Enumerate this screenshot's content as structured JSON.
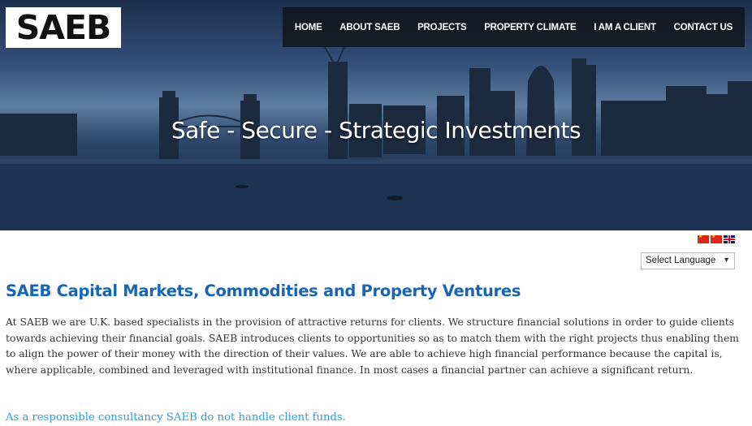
{
  "header": {
    "logo_text": "SAEB",
    "nav": [
      {
        "label": "HOME"
      },
      {
        "label": "ABOUT SAEB"
      },
      {
        "label": "PROJECTS"
      },
      {
        "label": "PROPERTY CLIMATE"
      },
      {
        "label": "I AM A CLIENT"
      },
      {
        "label": "CONTACT US"
      }
    ]
  },
  "hero": {
    "tagline": "Safe - Secure - Strategic Investments"
  },
  "language": {
    "flags": [
      "china-flag-icon",
      "china-flag-icon",
      "uk-flag-icon"
    ],
    "select_value": "Select Language"
  },
  "content": {
    "heading": "SAEB Capital Markets, Commodities and Property Ventures",
    "paragraph": "At SAEB we are U.K. based specialists in the provision of attractive returns for clients. We structure financial solutions in order to guide clients towards achieving their financial goals. SAEB introduces clients to opportunities so as to match them with the right projects thus enabling them to align the power of their money with the direction of their values. We are able to achieve high financial performance because the capital is, where applicable, combined and leveraged with institutional finance. In most cases a financial partner can achieve a significant return.",
    "note": "As a responsible consultancy SAEB do not handle client funds."
  },
  "colors": {
    "heading": "#1a64b5",
    "note": "#2c9ed8",
    "nav_background": "#10161e"
  }
}
